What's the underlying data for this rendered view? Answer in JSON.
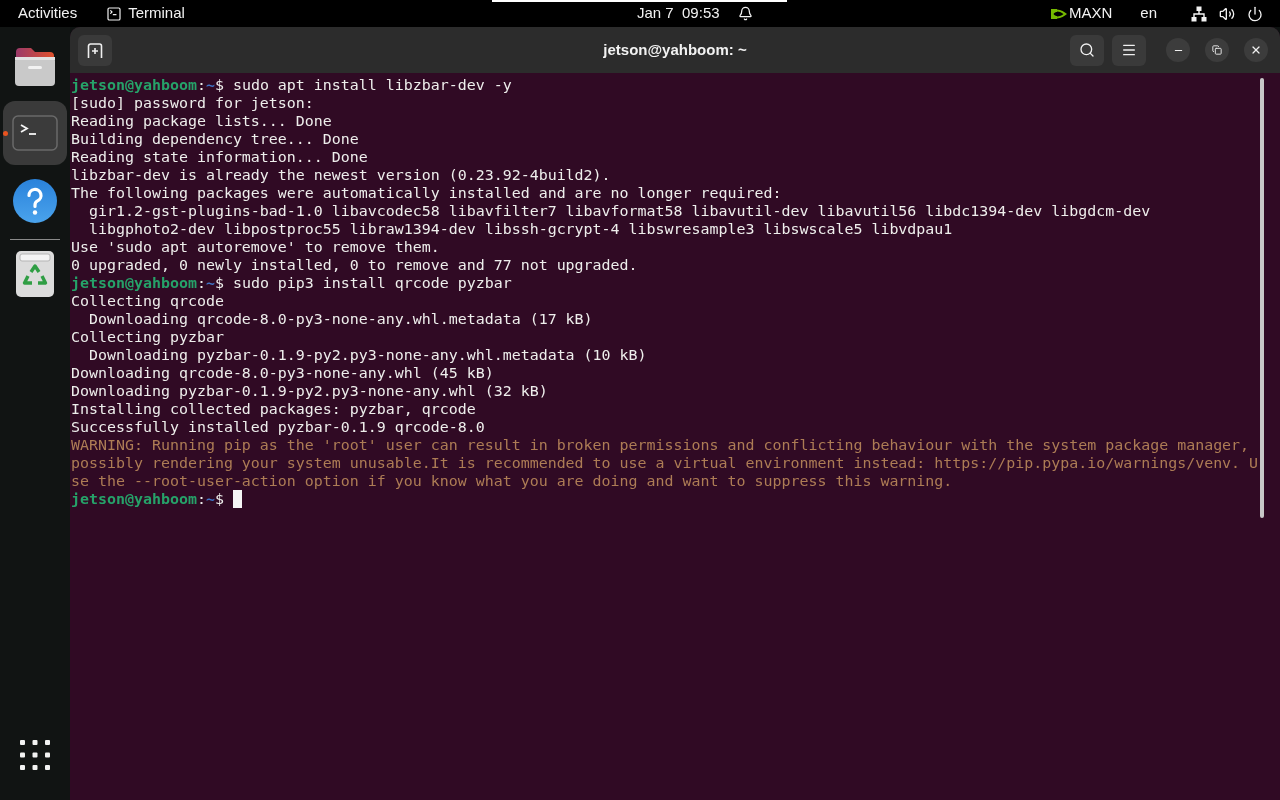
{
  "top_bar": {
    "activities": "Activities",
    "app_menu": "Terminal",
    "clock": "Jan 7  09:53",
    "power_mode": "MAXN",
    "input_source": "en"
  },
  "dock": {
    "items": [
      {
        "kind": "files",
        "selected": false,
        "running": false
      },
      {
        "kind": "terminal",
        "selected": true,
        "running": true
      },
      {
        "kind": "help",
        "selected": false,
        "running": false
      },
      {
        "kind": "trash",
        "selected": false,
        "running": false
      }
    ]
  },
  "window": {
    "title": "jetson@yahboom: ~"
  },
  "terminal": {
    "lines": [
      {
        "kind": "prompt",
        "user": "jetson@yahboom",
        "separator": ":",
        "path": "~",
        "symbol": "$",
        "command": "sudo apt install libzbar-dev -y",
        "cursor": false
      },
      {
        "kind": "output",
        "text": "[sudo] password for jetson:"
      },
      {
        "kind": "output",
        "text": "Reading package lists... Done"
      },
      {
        "kind": "output",
        "text": "Building dependency tree... Done"
      },
      {
        "kind": "output",
        "text": "Reading state information... Done"
      },
      {
        "kind": "output",
        "text": "libzbar-dev is already the newest version (0.23.92-4build2)."
      },
      {
        "kind": "output",
        "text": "The following packages were automatically installed and are no longer required:"
      },
      {
        "kind": "output",
        "text": "  gir1.2-gst-plugins-bad-1.0 libavcodec58 libavfilter7 libavformat58 libavutil-dev libavutil56 libdc1394-dev libgdcm-dev"
      },
      {
        "kind": "output",
        "text": "  libgphoto2-dev libpostproc55 libraw1394-dev libssh-gcrypt-4 libswresample3 libswscale5 libvdpau1"
      },
      {
        "kind": "output",
        "text": "Use 'sudo apt autoremove' to remove them."
      },
      {
        "kind": "output",
        "text": "0 upgraded, 0 newly installed, 0 to remove and 77 not upgraded."
      },
      {
        "kind": "prompt",
        "user": "jetson@yahboom",
        "separator": ":",
        "path": "~",
        "symbol": "$",
        "command": "sudo pip3 install qrcode pyzbar",
        "cursor": false
      },
      {
        "kind": "output",
        "text": "Collecting qrcode"
      },
      {
        "kind": "output",
        "text": "  Downloading qrcode-8.0-py3-none-any.whl.metadata (17 kB)"
      },
      {
        "kind": "output",
        "text": "Collecting pyzbar"
      },
      {
        "kind": "output",
        "text": "  Downloading pyzbar-0.1.9-py2.py3-none-any.whl.metadata (10 kB)"
      },
      {
        "kind": "output",
        "text": "Downloading qrcode-8.0-py3-none-any.whl (45 kB)"
      },
      {
        "kind": "output",
        "text": "Downloading pyzbar-0.1.9-py2.py3-none-any.whl (32 kB)"
      },
      {
        "kind": "output",
        "text": "Installing collected packages: pyzbar, qrcode"
      },
      {
        "kind": "output",
        "text": "Successfully installed pyzbar-0.1.9 qrcode-8.0"
      },
      {
        "kind": "warning",
        "text": "WARNING: Running pip as the 'root' user can result in broken permissions and conflicting behaviour with the system package manager,"
      },
      {
        "kind": "warning",
        "text": "possibly rendering your system unusable.It is recommended to use a virtual environment instead: https://pip.pypa.io/warnings/venv. U"
      },
      {
        "kind": "warning",
        "text": "se the --root-user-action option if you know what you are doing and want to suppress this warning."
      },
      {
        "kind": "prompt",
        "user": "jetson@yahboom",
        "separator": ":",
        "path": "~",
        "symbol": "$",
        "cursor": true
      }
    ]
  }
}
